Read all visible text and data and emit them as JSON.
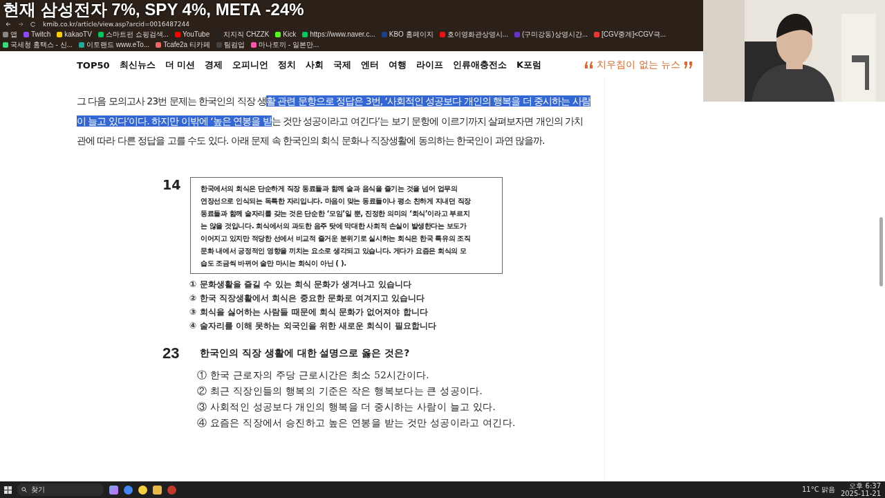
{
  "stream_caption": "현재 삼성전자 7%, SPY 4%, META -24%",
  "address_bar": {
    "url": "kmib.co.kr/article/view.asp?arcid=0016487244"
  },
  "bookmarks": [
    {
      "label": "앱"
    },
    {
      "label": "Twitch"
    },
    {
      "label": "kakaoTV"
    },
    {
      "label": "스마트펀 쇼핑검색..."
    },
    {
      "label": "YouTube"
    },
    {
      "label": "치지직 CHZZK"
    },
    {
      "label": "Kick"
    },
    {
      "label": "https://www.naver.c..."
    },
    {
      "label": "KBO 홈페이지"
    },
    {
      "label": "호이영화관상영시..."
    },
    {
      "label": "(구미강동)상영시간..."
    },
    {
      "label": "[CGV중계]<CGV극..."
    },
    {
      "label": "국세청 홈택스 - 신..."
    },
    {
      "label": "이토랜드 www.eTo..."
    },
    {
      "label": "Tcafe2a 티카페"
    },
    {
      "label": "팀컴업"
    },
    {
      "label": "마나토끼 - 일본만..."
    }
  ],
  "nav": {
    "items": [
      "TOP50",
      "최신뉴스",
      "더 미션",
      "경제",
      "오피니언",
      "정치",
      "사회",
      "국제",
      "엔터",
      "여행",
      "라이프",
      "인류애충전소",
      "K포럼"
    ],
    "slogan": "치우침이 없는 뉴스"
  },
  "article": {
    "paragraph": [
      {
        "text": "그 다음 모의고사 23번 문제는 한국인의 직장 생",
        "highlighted": false
      },
      {
        "text": "활 관련 문항으로 정답은 3번, ‘사회적인 성공보다 개인의 행복을 더 중시하는 사람이 늘고 있다’이다. 하지만 이밖에 ‘높은 연봉을 받",
        "highlighted": true
      },
      {
        "text": "는 것만 성공이라고 여긴다’는 보기 문항에 이르기까지 살펴보자면 개인의 가치관에 따라 다른 정답을 고를 수도 있다. 아래 문제 속 한국인의 회식 문화나 직장생활에 동의하는 한국인이 과연 많을까.",
        "highlighted": false
      }
    ]
  },
  "exam": {
    "questions": [
      {
        "kind": "passage",
        "number": "14",
        "passage": [
          "한국에서의 회식은 단순하게 직장 동료들과 함께 술과 음식을 즐기는 것을 넘어 업무의",
          "연장선으로 인식되는 독특한 자리입니다. 마음이 맞는 동료들이나 평소 친하게 지내던 직장",
          "동료들과 함께 술자리를 갖는 것은 단순한 ‘모임’일 뿐, 진정한 의미의 ‘회식’이라고 부르지",
          "는 않을 것입니다. 회식에서의 과도한 음주 탓에 막대한 사회적 손실이 발생한다는 보도가",
          "이어지고 있지만 적당한 선에서 비교적 즐거운 분위기로 실시하는 회식은 한국 특유의 조직",
          "문화 내에서 긍정적인 영향을 끼치는 요소로 생각되고 있습니다. 게다가 요즘은 회식의 모",
          "습도 조금씩 바뀌어 술만 마시는 회식이 아닌 (                              )."
        ],
        "options": [
          "① 문화생활을 즐길 수 있는 회식 문화가 생겨나고 있습니다",
          "② 한국 직장생활에서 회식은 중요한 문화로 여겨지고 있습니다",
          "③ 회식을 싫어하는 사람들 때문에 회식 문화가 없어져야 합니다",
          "④ 술자리를 이해 못하는 외국인을 위한 새로운 회식이 필요합니다"
        ]
      },
      {
        "kind": "question",
        "number": "23",
        "question": "한국인의 직장 생활에 대한 설명으로 옳은 것은?",
        "options": [
          "① 한국 근로자의 주당 근로시간은 최소 52시간이다.",
          "② 최근 직장인들의 행복의 기준은 작은 행복보다는 큰 성공이다.",
          "③ 사회적인 성공보다 개인의 행복을 더 중시하는 사람이 늘고 있다.",
          "④ 요즘은 직장에서 승진하고 높은 연봉을 받는 것만 성공이라고 여긴다."
        ]
      }
    ]
  },
  "taskbar": {
    "search": "찾기",
    "weather": "11°C 맑음",
    "time": "오후 6:37",
    "date": "2025-11-21"
  }
}
